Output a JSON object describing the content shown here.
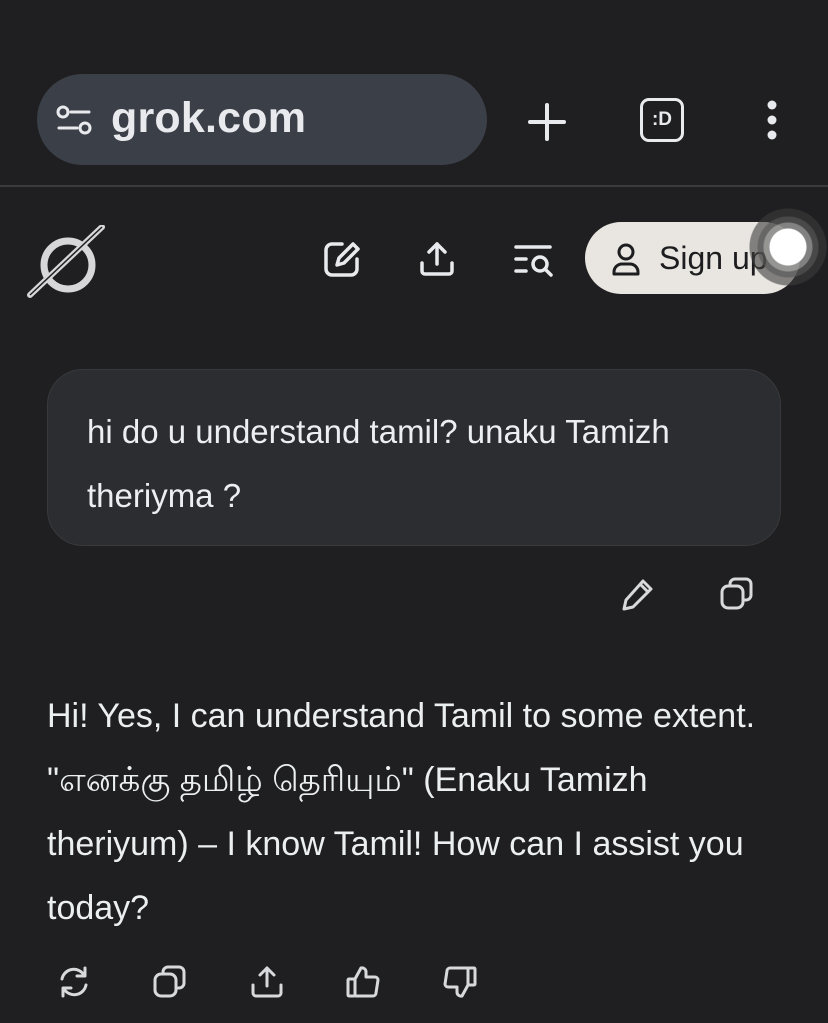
{
  "browser": {
    "url": "grok.com",
    "icons": {
      "site_info": "tune-icon",
      "new_tab": "plus-icon",
      "tab_switcher": "tab-switcher-icon",
      "menu": "kebab-menu-icon"
    },
    "tab_switcher_label": ":D"
  },
  "header": {
    "logo": "grok-logo",
    "signup_label": "Sign up",
    "icons": [
      "new-chat-icon",
      "share-icon",
      "history-search-icon",
      "user-icon"
    ]
  },
  "conversation": {
    "user_message": "hi do u understand tamil? unaku Tamizh theriyma ?",
    "user_message_actions": [
      "edit-icon",
      "copy-icon"
    ],
    "assistant_message": "Hi! Yes, I can understand Tamil to some extent. \"எனக்கு தமிழ் தெரியும்\" (Enaku Tamizh theriyum) – I know Tamil! How can I assist you today?",
    "assistant_actions": [
      "regenerate-icon",
      "copy-icon",
      "share-icon",
      "thumbs-up-icon",
      "thumbs-down-icon"
    ]
  },
  "colors": {
    "background": "#1f1f21",
    "url_pill": "#3b3f48",
    "user_bubble": "#2c2d30",
    "signup_bg": "#e9e6e1",
    "text": "#eceff1"
  }
}
